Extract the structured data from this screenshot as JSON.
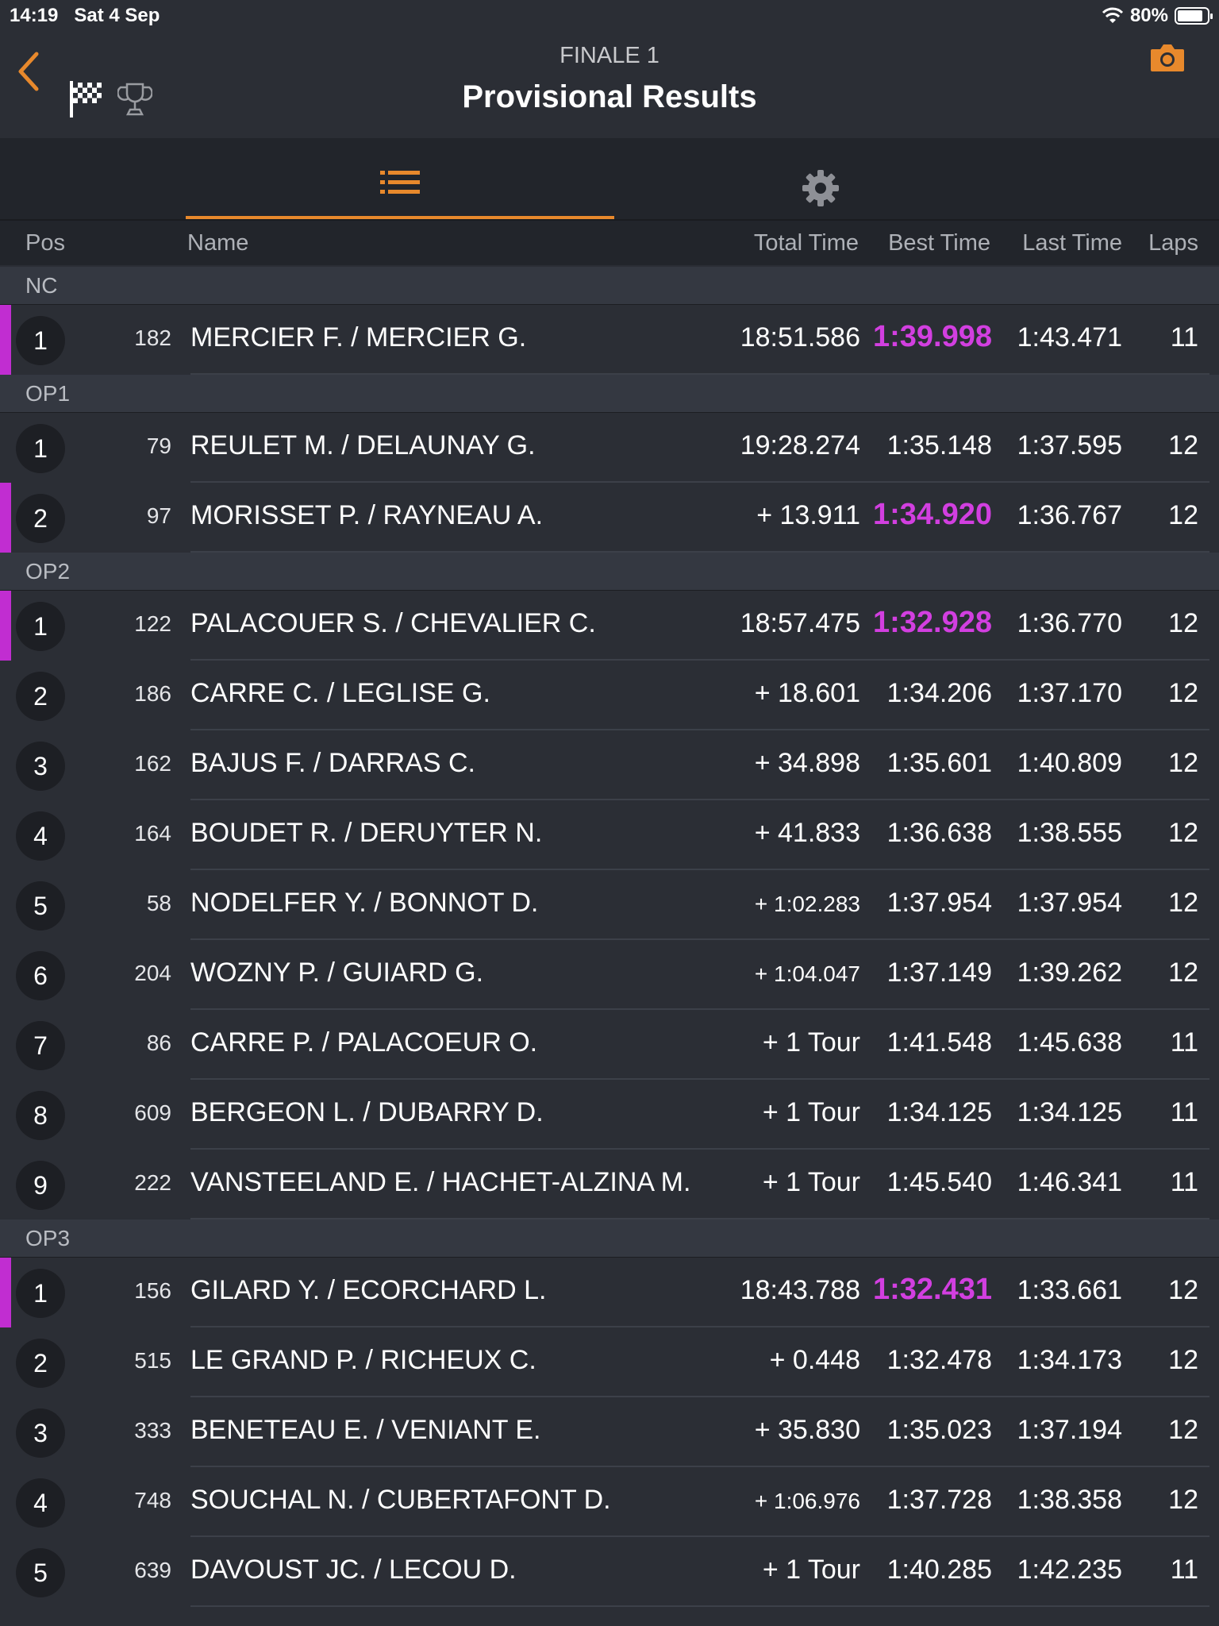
{
  "statusbar": {
    "time": "14:19   Sat 4 Sep",
    "battery": "80%"
  },
  "header": {
    "subtitle": "FINALE 1",
    "title": "Provisional Results"
  },
  "icons": {
    "back": "chevron-left-icon",
    "flag": "checkered-flag-icon",
    "trophy": "trophy-icon",
    "camera": "camera-icon",
    "list": "list-icon",
    "settings": "gear-icon"
  },
  "colors": {
    "accent": "#e8892c",
    "fastest": "#d23fe0",
    "background": "#2b2e35"
  },
  "columns": {
    "pos": "Pos",
    "name": "Name",
    "total": "Total Time",
    "best": "Best Time",
    "last": "Last Time",
    "laps": "Laps"
  },
  "sections": [
    {
      "label": "NC",
      "rows": [
        {
          "pos": "1",
          "num": "182",
          "name": "MERCIER F. / MERCIER G.",
          "total": "18:51.586",
          "best": "1:39.998",
          "last": "1:43.471",
          "laps": "11",
          "fastest": true
        }
      ]
    },
    {
      "label": "OP1",
      "rows": [
        {
          "pos": "1",
          "num": "79",
          "name": "REULET M. / DELAUNAY G.",
          "total": "19:28.274",
          "best": "1:35.148",
          "last": "1:37.595",
          "laps": "12",
          "fastest": false
        },
        {
          "pos": "2",
          "num": "97",
          "name": "MORISSET P. / RAYNEAU A.",
          "total": "+ 13.911",
          "best": "1:34.920",
          "last": "1:36.767",
          "laps": "12",
          "fastest": true
        }
      ]
    },
    {
      "label": "OP2",
      "rows": [
        {
          "pos": "1",
          "num": "122",
          "name": "PALACOUER S. / CHEVALIER C.",
          "total": "18:57.475",
          "best": "1:32.928",
          "last": "1:36.770",
          "laps": "12",
          "fastest": true
        },
        {
          "pos": "2",
          "num": "186",
          "name": "CARRE C. / LEGLISE G.",
          "total": "+ 18.601",
          "best": "1:34.206",
          "last": "1:37.170",
          "laps": "12",
          "fastest": false
        },
        {
          "pos": "3",
          "num": "162",
          "name": "BAJUS F. / DARRAS C.",
          "total": "+ 34.898",
          "best": "1:35.601",
          "last": "1:40.809",
          "laps": "12",
          "fastest": false
        },
        {
          "pos": "4",
          "num": "164",
          "name": "BOUDET R. / DERUYTER N.",
          "total": "+ 41.833",
          "best": "1:36.638",
          "last": "1:38.555",
          "laps": "12",
          "fastest": false
        },
        {
          "pos": "5",
          "num": "58",
          "name": "NODELFER Y. / BONNOT D.",
          "total": "+ 1:02.283",
          "best": "1:37.954",
          "last": "1:37.954",
          "laps": "12",
          "fastest": false
        },
        {
          "pos": "6",
          "num": "204",
          "name": "WOZNY P. / GUIARD G.",
          "total": "+ 1:04.047",
          "best": "1:37.149",
          "last": "1:39.262",
          "laps": "12",
          "fastest": false
        },
        {
          "pos": "7",
          "num": "86",
          "name": "CARRE P. / PALACOEUR O.",
          "total": "+ 1 Tour",
          "best": "1:41.548",
          "last": "1:45.638",
          "laps": "11",
          "fastest": false
        },
        {
          "pos": "8",
          "num": "609",
          "name": "BERGEON L. / DUBARRY D.",
          "total": "+ 1 Tour",
          "best": "1:34.125",
          "last": "1:34.125",
          "laps": "11",
          "fastest": false
        },
        {
          "pos": "9",
          "num": "222",
          "name": "VANSTEELAND E. / HACHET-ALZINA M.",
          "total": "+ 1 Tour",
          "best": "1:45.540",
          "last": "1:46.341",
          "laps": "11",
          "fastest": false
        }
      ]
    },
    {
      "label": "OP3",
      "rows": [
        {
          "pos": "1",
          "num": "156",
          "name": "GILARD Y. / ECORCHARD L.",
          "total": "18:43.788",
          "best": "1:32.431",
          "last": "1:33.661",
          "laps": "12",
          "fastest": true
        },
        {
          "pos": "2",
          "num": "515",
          "name": "LE GRAND P. / RICHEUX C.",
          "total": "+ 0.448",
          "best": "1:32.478",
          "last": "1:34.173",
          "laps": "12",
          "fastest": false
        },
        {
          "pos": "3",
          "num": "333",
          "name": "BENETEAU E. / VENIANT E.",
          "total": "+ 35.830",
          "best": "1:35.023",
          "last": "1:37.194",
          "laps": "12",
          "fastest": false
        },
        {
          "pos": "4",
          "num": "748",
          "name": "SOUCHAL N. / CUBERTAFONT D.",
          "total": "+ 1:06.976",
          "best": "1:37.728",
          "last": "1:38.358",
          "laps": "12",
          "fastest": false
        },
        {
          "pos": "5",
          "num": "639",
          "name": "DAVOUST JC. / LECOU D.",
          "total": "+ 1 Tour",
          "best": "1:40.285",
          "last": "1:42.235",
          "laps": "11",
          "fastest": false
        }
      ]
    }
  ]
}
